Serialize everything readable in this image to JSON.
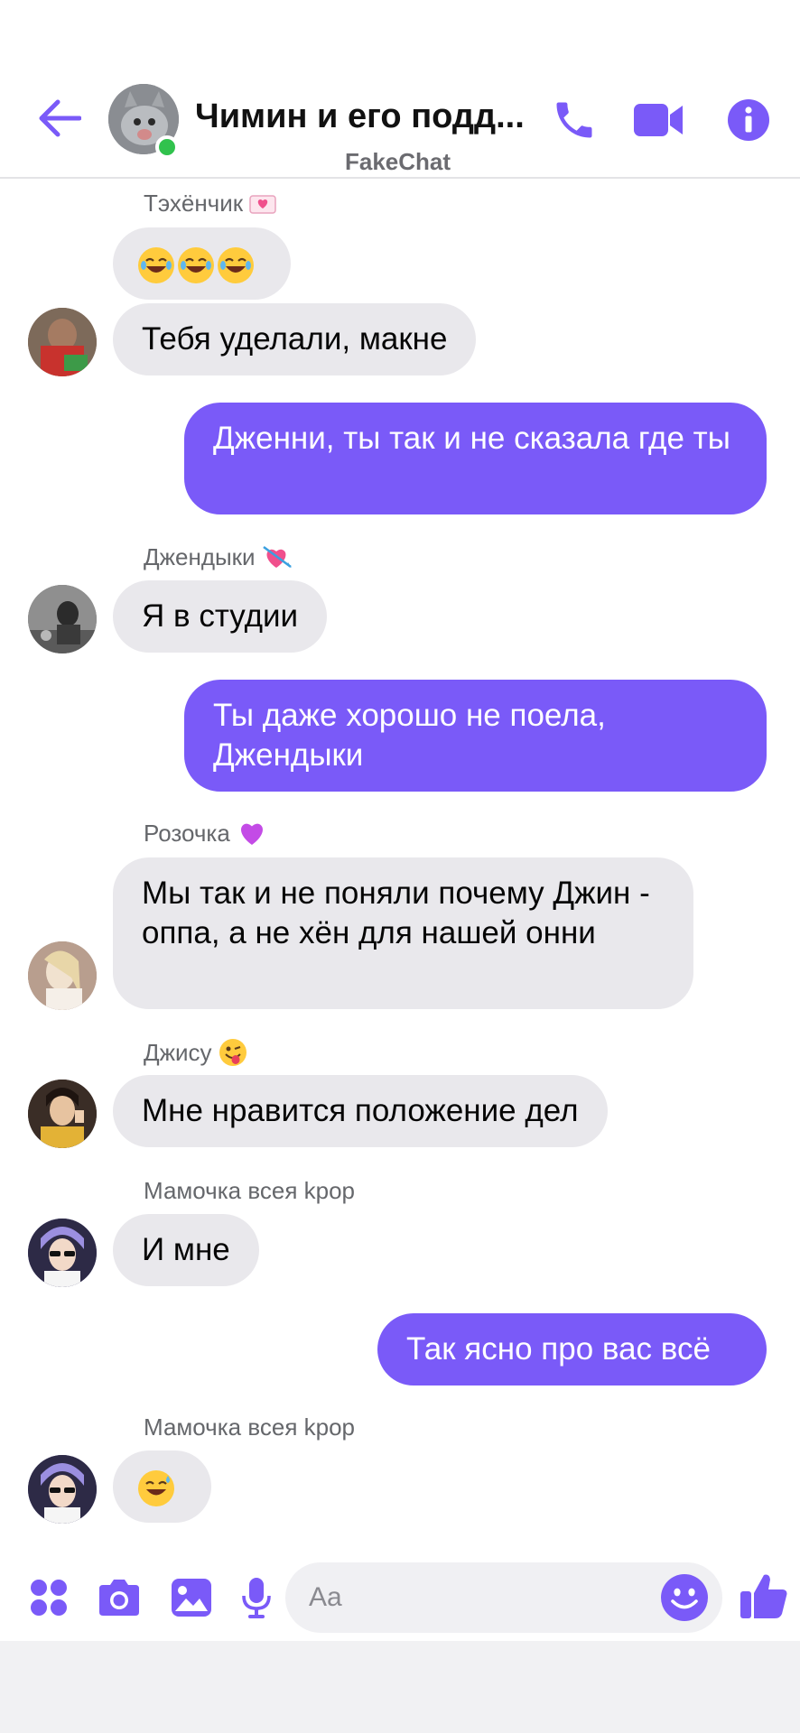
{
  "header": {
    "title": "Чимин и его подд...",
    "subtitle": "FakeChat"
  },
  "messages": [
    {
      "sender": "Тэхёнчик",
      "emoji_count": 3,
      "text": "Тебя уделали,  макне"
    },
    {
      "out1": "Дженни, ты так и не сказала где ты"
    },
    {
      "sender": "Джендыки",
      "text": "Я в студии"
    },
    {
      "out2": "Ты даже хорошо не поела, Джендыки"
    },
    {
      "sender": "Розочка",
      "text": "Мы так и не поняли почему Джин - оппа, а не хён для нашей онни"
    },
    {
      "sender": "Джису",
      "text": "Мне нравится положение дел"
    },
    {
      "sender": "Мамочка всея kpop",
      "text": "И мне"
    },
    {
      "out3": "Так ясно про вас всё"
    },
    {
      "sender": "Мамочка всея kpop",
      "emoji_count": 1
    }
  ],
  "chat": {
    "s1": "Тэхёнчик",
    "m1b": "Тебя уделали,  макне",
    "o1": "Дженни, ты так и не сказала где ты",
    "s2": "Джендыки",
    "m2": "Я в студии",
    "o2": "Ты даже хорошо не поела, Джендыки",
    "s3": "Розочка",
    "m3": "Мы так и не поняли почему Джин - оппа, а не хён для нашей онни",
    "s4": "Джису",
    "m4": "Мне нравится положение дел",
    "s5": "Мамочка всея kpop",
    "m5": "И мне",
    "o3": "Так ясно про вас всё",
    "s6": "Мамочка всея kpop"
  },
  "composer": {
    "placeholder": "Aa"
  },
  "icons": {
    "back": "arrow-left-icon",
    "call": "phone-icon",
    "video": "video-camera-icon",
    "info": "info-icon",
    "apps": "four-dots-icon",
    "camera": "camera-icon",
    "gallery": "image-icon",
    "mic": "microphone-icon",
    "emoji": "smiley-icon",
    "like": "thumbs-up-icon"
  },
  "colors": {
    "accent": "#7a5af8",
    "incoming_bubble": "#e9e8ec",
    "online": "#31c24d"
  }
}
